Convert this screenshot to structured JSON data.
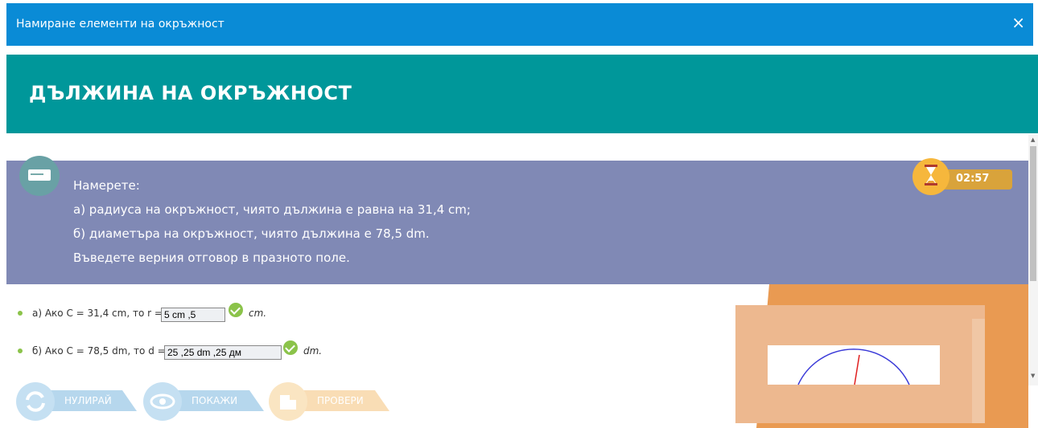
{
  "window": {
    "title": "Намиране елементи на окръжност",
    "close_icon": "×"
  },
  "banner": {
    "heading": "ДЪЛЖИНА  НА ОКРЪЖНОСТ"
  },
  "task": {
    "lines": [
      "Намерете:",
      "а) радиуса на окръжност, чиято дължина е равна на 31,4 cm;",
      "б) диаметъра на окръжност, чиято дължина е 78,5 dm.",
      "Въведете верния отговор в празното поле."
    ]
  },
  "timer": {
    "value": "02:57"
  },
  "questions": [
    {
      "label": "а) Ако C = 31,4 cm, то r =",
      "input_value": "5 cm ,5",
      "unit": "cm."
    },
    {
      "label": "б) Ако C = 78,5 dm, то d =",
      "input_value": "25 ,25 dm ,25 дм",
      "unit": "dm."
    }
  ],
  "buttons": {
    "reset": "НУЛИРАЙ",
    "show": "ПОКАЖИ",
    "check": "ПРОВЕРИ"
  },
  "colors": {
    "header": "#0a8bd6",
    "banner": "#00979a",
    "task_bg": "#8089b5",
    "timer": "#f6b73c",
    "correct": "#8bc34a",
    "illustration": "#e99a52"
  }
}
